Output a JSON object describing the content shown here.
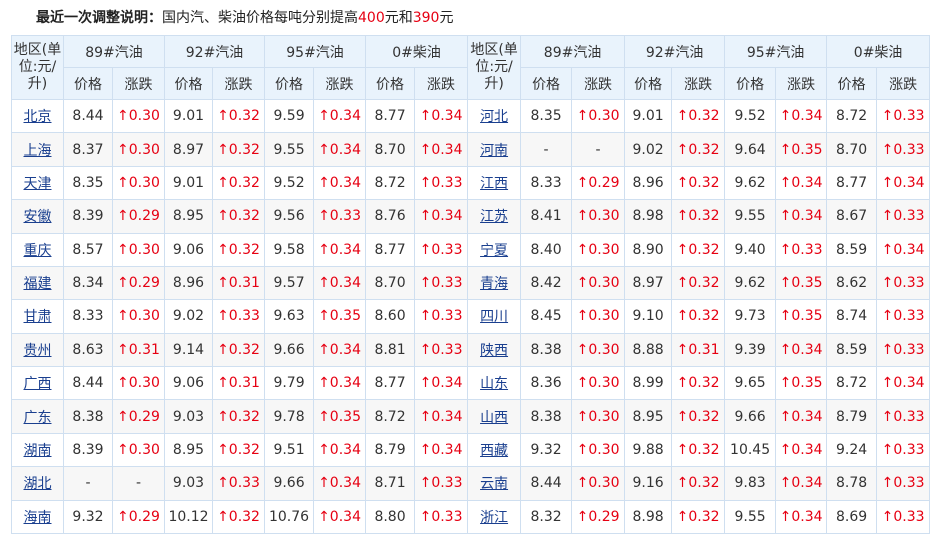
{
  "notice": {
    "lead": "最近一次调整说明：",
    "text_before": "国内汽、柴油价格每吨分别提高",
    "gas_increase": "400",
    "text_mid": "元和",
    "diesel_increase": "390",
    "text_after": "元"
  },
  "header": {
    "region_label": "地区(单位:元/升)",
    "fuels": [
      "89#汽油",
      "92#汽油",
      "95#汽油",
      "0#柴油"
    ],
    "price_label": "价格",
    "change_label": "涨跌"
  },
  "colors": {
    "up": "#e60012",
    "header_bg": "#e9f3fc",
    "border": "#cfdff0",
    "link": "#1a3f8f"
  },
  "rows": [
    {
      "left": {
        "region": "北京",
        "values": [
          [
            "8.44",
            "↑0.30"
          ],
          [
            "9.01",
            "↑0.32"
          ],
          [
            "9.59",
            "↑0.34"
          ],
          [
            "8.77",
            "↑0.34"
          ]
        ]
      },
      "right": {
        "region": "河北",
        "values": [
          [
            "8.35",
            "↑0.30"
          ],
          [
            "9.01",
            "↑0.32"
          ],
          [
            "9.52",
            "↑0.34"
          ],
          [
            "8.72",
            "↑0.33"
          ]
        ]
      }
    },
    {
      "left": {
        "region": "上海",
        "values": [
          [
            "8.37",
            "↑0.30"
          ],
          [
            "8.97",
            "↑0.32"
          ],
          [
            "9.55",
            "↑0.34"
          ],
          [
            "8.70",
            "↑0.34"
          ]
        ]
      },
      "right": {
        "region": "河南",
        "values": [
          [
            "-",
            "-"
          ],
          [
            "9.02",
            "↑0.32"
          ],
          [
            "9.64",
            "↑0.35"
          ],
          [
            "8.70",
            "↑0.33"
          ]
        ]
      }
    },
    {
      "left": {
        "region": "天津",
        "values": [
          [
            "8.35",
            "↑0.30"
          ],
          [
            "9.01",
            "↑0.32"
          ],
          [
            "9.52",
            "↑0.34"
          ],
          [
            "8.72",
            "↑0.33"
          ]
        ]
      },
      "right": {
        "region": "江西",
        "values": [
          [
            "8.33",
            "↑0.29"
          ],
          [
            "8.96",
            "↑0.32"
          ],
          [
            "9.62",
            "↑0.34"
          ],
          [
            "8.77",
            "↑0.34"
          ]
        ]
      }
    },
    {
      "left": {
        "region": "安徽",
        "values": [
          [
            "8.39",
            "↑0.29"
          ],
          [
            "8.95",
            "↑0.32"
          ],
          [
            "9.56",
            "↑0.33"
          ],
          [
            "8.76",
            "↑0.34"
          ]
        ]
      },
      "right": {
        "region": "江苏",
        "values": [
          [
            "8.41",
            "↑0.30"
          ],
          [
            "8.98",
            "↑0.32"
          ],
          [
            "9.55",
            "↑0.34"
          ],
          [
            "8.67",
            "↑0.33"
          ]
        ]
      }
    },
    {
      "left": {
        "region": "重庆",
        "values": [
          [
            "8.57",
            "↑0.30"
          ],
          [
            "9.06",
            "↑0.32"
          ],
          [
            "9.58",
            "↑0.34"
          ],
          [
            "8.77",
            "↑0.33"
          ]
        ]
      },
      "right": {
        "region": "宁夏",
        "values": [
          [
            "8.40",
            "↑0.30"
          ],
          [
            "8.90",
            "↑0.32"
          ],
          [
            "9.40",
            "↑0.33"
          ],
          [
            "8.59",
            "↑0.34"
          ]
        ]
      }
    },
    {
      "left": {
        "region": "福建",
        "values": [
          [
            "8.34",
            "↑0.29"
          ],
          [
            "8.96",
            "↑0.31"
          ],
          [
            "9.57",
            "↑0.34"
          ],
          [
            "8.70",
            "↑0.33"
          ]
        ]
      },
      "right": {
        "region": "青海",
        "values": [
          [
            "8.42",
            "↑0.30"
          ],
          [
            "8.97",
            "↑0.32"
          ],
          [
            "9.62",
            "↑0.35"
          ],
          [
            "8.62",
            "↑0.33"
          ]
        ]
      }
    },
    {
      "left": {
        "region": "甘肃",
        "values": [
          [
            "8.33",
            "↑0.30"
          ],
          [
            "9.02",
            "↑0.33"
          ],
          [
            "9.63",
            "↑0.35"
          ],
          [
            "8.60",
            "↑0.33"
          ]
        ]
      },
      "right": {
        "region": "四川",
        "values": [
          [
            "8.45",
            "↑0.30"
          ],
          [
            "9.10",
            "↑0.32"
          ],
          [
            "9.73",
            "↑0.35"
          ],
          [
            "8.74",
            "↑0.33"
          ]
        ]
      }
    },
    {
      "left": {
        "region": "贵州",
        "values": [
          [
            "8.63",
            "↑0.31"
          ],
          [
            "9.14",
            "↑0.32"
          ],
          [
            "9.66",
            "↑0.34"
          ],
          [
            "8.81",
            "↑0.33"
          ]
        ]
      },
      "right": {
        "region": "陕西",
        "values": [
          [
            "8.38",
            "↑0.30"
          ],
          [
            "8.88",
            "↑0.31"
          ],
          [
            "9.39",
            "↑0.34"
          ],
          [
            "8.59",
            "↑0.33"
          ]
        ]
      }
    },
    {
      "left": {
        "region": "广西",
        "values": [
          [
            "8.44",
            "↑0.30"
          ],
          [
            "9.06",
            "↑0.31"
          ],
          [
            "9.79",
            "↑0.34"
          ],
          [
            "8.77",
            "↑0.34"
          ]
        ]
      },
      "right": {
        "region": "山东",
        "values": [
          [
            "8.36",
            "↑0.30"
          ],
          [
            "8.99",
            "↑0.32"
          ],
          [
            "9.65",
            "↑0.35"
          ],
          [
            "8.72",
            "↑0.34"
          ]
        ]
      }
    },
    {
      "left": {
        "region": "广东",
        "values": [
          [
            "8.38",
            "↑0.29"
          ],
          [
            "9.03",
            "↑0.32"
          ],
          [
            "9.78",
            "↑0.35"
          ],
          [
            "8.72",
            "↑0.34"
          ]
        ]
      },
      "right": {
        "region": "山西",
        "values": [
          [
            "8.38",
            "↑0.30"
          ],
          [
            "8.95",
            "↑0.32"
          ],
          [
            "9.66",
            "↑0.34"
          ],
          [
            "8.79",
            "↑0.33"
          ]
        ]
      }
    },
    {
      "left": {
        "region": "湖南",
        "values": [
          [
            "8.39",
            "↑0.30"
          ],
          [
            "8.95",
            "↑0.32"
          ],
          [
            "9.51",
            "↑0.34"
          ],
          [
            "8.79",
            "↑0.34"
          ]
        ]
      },
      "right": {
        "region": "西藏",
        "values": [
          [
            "9.32",
            "↑0.30"
          ],
          [
            "9.88",
            "↑0.32"
          ],
          [
            "10.45",
            "↑0.34"
          ],
          [
            "9.24",
            "↑0.33"
          ]
        ]
      }
    },
    {
      "left": {
        "region": "湖北",
        "values": [
          [
            "-",
            "-"
          ],
          [
            "9.03",
            "↑0.33"
          ],
          [
            "9.66",
            "↑0.34"
          ],
          [
            "8.71",
            "↑0.33"
          ]
        ]
      },
      "right": {
        "region": "云南",
        "values": [
          [
            "8.44",
            "↑0.30"
          ],
          [
            "9.16",
            "↑0.32"
          ],
          [
            "9.83",
            "↑0.34"
          ],
          [
            "8.78",
            "↑0.33"
          ]
        ]
      }
    },
    {
      "left": {
        "region": "海南",
        "values": [
          [
            "9.32",
            "↑0.29"
          ],
          [
            "10.12",
            "↑0.32"
          ],
          [
            "10.76",
            "↑0.34"
          ],
          [
            "8.80",
            "↑0.33"
          ]
        ]
      },
      "right": {
        "region": "浙江",
        "values": [
          [
            "8.32",
            "↑0.29"
          ],
          [
            "8.98",
            "↑0.32"
          ],
          [
            "9.55",
            "↑0.34"
          ],
          [
            "8.69",
            "↑0.33"
          ]
        ]
      }
    }
  ]
}
